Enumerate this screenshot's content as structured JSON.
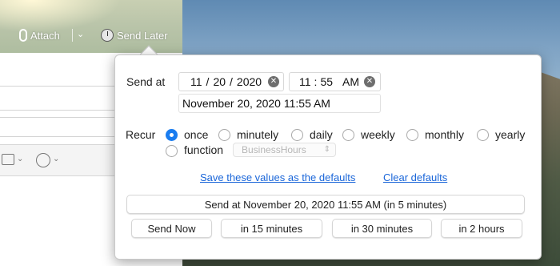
{
  "toolbar": {
    "attach_label": "Attach",
    "send_later_label": "Send Later"
  },
  "send_at": {
    "label": "Send at",
    "date": {
      "month": "11",
      "day": "20",
      "year": "2020"
    },
    "time": {
      "hour": "11",
      "minute": "55",
      "ampm": "AM"
    },
    "summary": "November 20, 2020 11:55 AM"
  },
  "recur": {
    "label": "Recur",
    "options": [
      {
        "label": "once",
        "selected": true
      },
      {
        "label": "minutely",
        "selected": false
      },
      {
        "label": "daily",
        "selected": false
      },
      {
        "label": "weekly",
        "selected": false
      },
      {
        "label": "monthly",
        "selected": false
      },
      {
        "label": "yearly",
        "selected": false
      },
      {
        "label": "function",
        "selected": false
      }
    ],
    "function_select": {
      "value": "BusinessHours"
    }
  },
  "links": {
    "save_defaults": "Save these values as the defaults",
    "clear_defaults": "Clear defaults"
  },
  "buttons": {
    "send_at": "Send at November 20, 2020 11:55 AM (in 5 minutes)",
    "send_now": "Send Now",
    "in_15": "in 15 minutes",
    "in_30": "in 30 minutes",
    "in_2h": "in 2 hours"
  },
  "colors": {
    "accent": "#1a7df0",
    "link": "#1a66d9"
  }
}
